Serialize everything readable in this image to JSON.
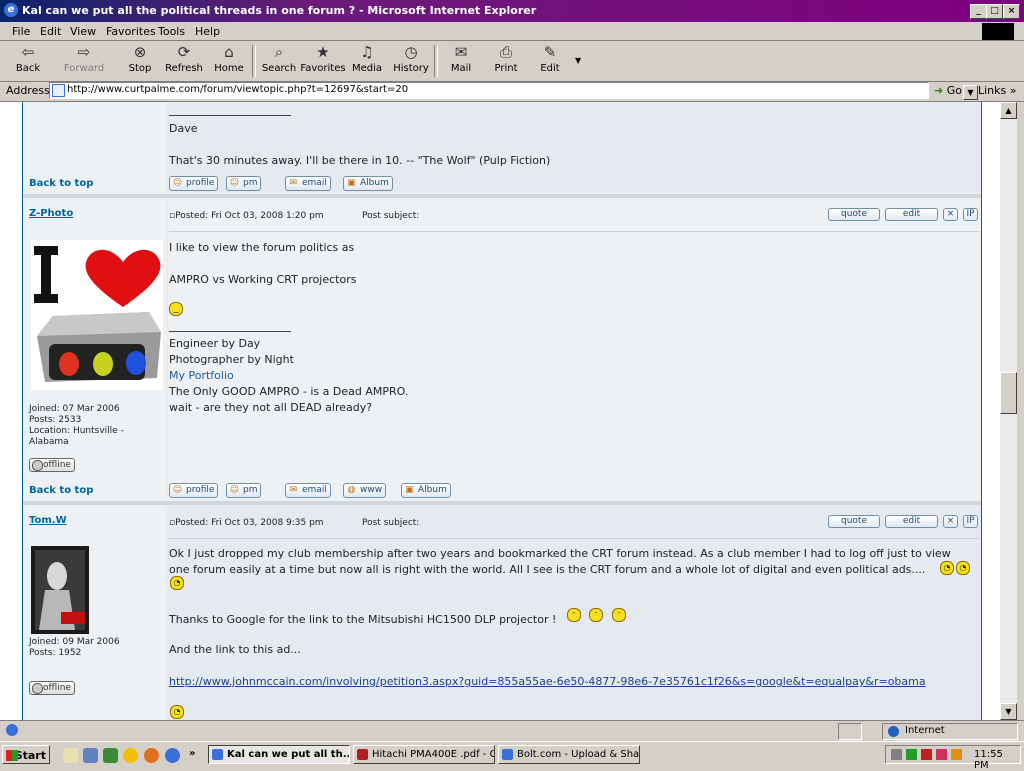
{
  "window": {
    "title": "Kal can we put all the political threads in one forum ? - Microsoft Internet Explorer",
    "controls": [
      "_",
      "□",
      "×"
    ]
  },
  "menu": [
    "File",
    "Edit",
    "View",
    "Favorites",
    "Tools",
    "Help"
  ],
  "toolbar": [
    {
      "label": "Back",
      "icon": "back-arrow-icon",
      "glyph": "⇦",
      "enabled": true
    },
    {
      "label": "Forward",
      "icon": "forward-arrow-icon",
      "glyph": "⇨",
      "enabled": false
    },
    {
      "label": "Stop",
      "icon": "stop-icon",
      "glyph": "⊗",
      "enabled": true
    },
    {
      "label": "Refresh",
      "icon": "refresh-icon",
      "glyph": "⟳",
      "enabled": true
    },
    {
      "label": "Home",
      "icon": "home-icon",
      "glyph": "⌂",
      "enabled": true
    },
    {
      "label": "Search",
      "icon": "search-icon",
      "glyph": "⌕",
      "enabled": true
    },
    {
      "label": "Favorites",
      "icon": "favorites-icon",
      "glyph": "★",
      "enabled": true
    },
    {
      "label": "Media",
      "icon": "media-icon",
      "glyph": "♫",
      "enabled": true
    },
    {
      "label": "History",
      "icon": "history-icon",
      "glyph": "◷",
      "enabled": true
    },
    {
      "label": "Mail",
      "icon": "mail-icon",
      "glyph": "✉",
      "enabled": true
    },
    {
      "label": "Print",
      "icon": "print-icon",
      "glyph": "⎙",
      "enabled": true
    },
    {
      "label": "Edit",
      "icon": "edit-icon",
      "glyph": "✎",
      "enabled": true
    }
  ],
  "address": {
    "label": "Address",
    "url": "http://www.curtpalme.com/forum/viewtopic.php?t=12697&start=20",
    "go": "Go",
    "links": "Links"
  },
  "forum": {
    "back_to_top": "Back to top",
    "prev_post": {
      "sig_name": "Dave",
      "sig_quote": "That's 30 minutes away. I'll be there in 10. -- \"The Wolf\" (Pulp Fiction)",
      "buttons": [
        "profile",
        "pm",
        "email",
        "Album"
      ]
    },
    "post1": {
      "username": "Z-Photo",
      "posted": "Posted: Fri Oct 03, 2008 1:20 pm",
      "subject_label": "Post subject:",
      "header_buttons": [
        "quote",
        "edit"
      ],
      "lines": [
        "I like to view the forum politics as",
        "AMPRO vs Working CRT projectors"
      ],
      "signature": [
        "Engineer by Day",
        "Photographer by Night",
        "My Portfolio",
        "The Only GOOD AMPRO - is a Dead AMPRO.",
        "wait - are they not all DEAD already?"
      ],
      "joined": "Joined: 07 Mar 2006",
      "posts": "Posts: 2533",
      "location": "Location: Huntsville - Alabama",
      "status": "offline",
      "buttons": [
        "profile",
        "pm",
        "email",
        "www",
        "Album"
      ]
    },
    "post2": {
      "username": "Tom.W",
      "posted": "Posted: Fri Oct 03, 2008 9:35 pm",
      "subject_label": "Post subject:",
      "header_buttons": [
        "quote",
        "edit"
      ],
      "para1_line1": "Ok I just dropped my club membership after two years and bookmarked the CRT forum instead. As a club member I had to log off just to view",
      "para1_line2": "one forum easily at a time but now all is right with the world. All I see is the CRT forum and a whole lot of digital and even political ads....",
      "para2": "Thanks to Google for the link to the Mitsubishi HC1500 DLP projector !",
      "para3": "And the link to this ad...",
      "link": "http://www.johnmccain.com/involving/petition3.aspx?guid=855a55ae-6e50-4877-98e6-7e35761c1f26&s=google&t=equalpay&r=obama",
      "joined": "Joined: 09 Mar 2006",
      "posts": "Posts: 1952",
      "status": "offline"
    }
  },
  "statusbar": {
    "zone": "Internet"
  },
  "taskbar": {
    "start": "Start",
    "tasks": [
      "Kal can we put all th...",
      "Hitachi PMA400E .pdf - G...",
      "Bolt.com - Upload & Share ..."
    ],
    "clock": "11:55 PM"
  },
  "colors": {
    "title_gradient": [
      "#0a246a",
      "#800080"
    ],
    "forum_link": "#006699",
    "chrome": "#d4d0c8"
  }
}
